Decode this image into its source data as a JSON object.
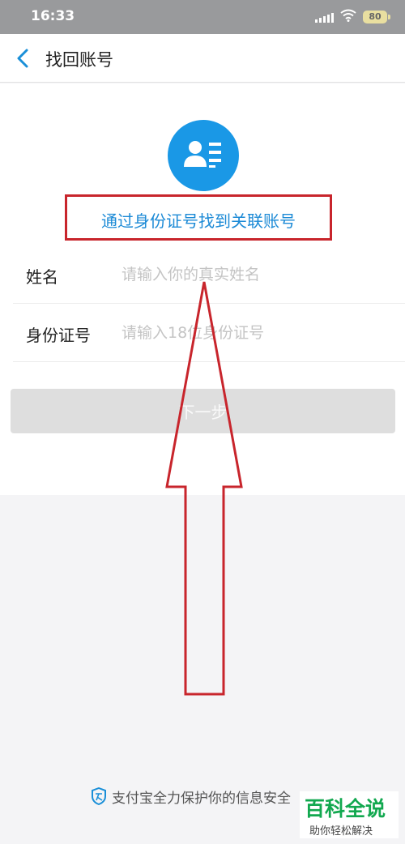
{
  "status_bar": {
    "time": "16:33",
    "battery": "80"
  },
  "nav": {
    "title": "找回账号",
    "back_icon": "chevron-left-icon"
  },
  "colors": {
    "accent": "#1a98e6",
    "highlight_border": "#c8252c",
    "watermark_green": "#12a84f"
  },
  "hero": {
    "icon": "id-card-user-icon",
    "headline": "通过身份证号找到关联账号"
  },
  "form": {
    "name": {
      "label": "姓名",
      "placeholder": "请输入你的真实姓名",
      "value": ""
    },
    "id_number": {
      "label": "身份证号",
      "placeholder": "请输入18位身份证号",
      "value": ""
    },
    "next_label": "下一步"
  },
  "footer": {
    "security_icon": "shield-icon",
    "security_text": "支付宝全力保护你的信息安全"
  },
  "watermark": {
    "main": "百科全说",
    "sub": "助你轻松解决"
  }
}
